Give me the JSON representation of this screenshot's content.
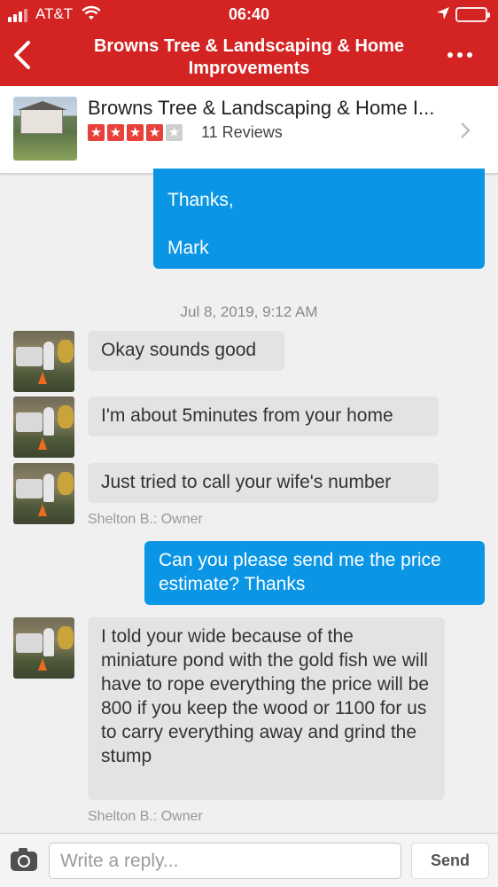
{
  "status_bar": {
    "carrier": "AT&T",
    "time": "06:40"
  },
  "nav": {
    "title": "Browns Tree & Landscaping & Home Improvements",
    "back_icon": "chevron-left-icon",
    "more_icon": "more-icon"
  },
  "business": {
    "name": "Browns Tree & Landscaping & Home I...",
    "rating": 4,
    "rating_max": 5,
    "reviews": "11 Reviews"
  },
  "messages": {
    "m1_line1": "Thanks,",
    "m1_line2": "Mark",
    "date": "Jul 8, 2019, 9:12 AM",
    "m2": "Okay sounds good",
    "m3": "I'm about 5minutes from your home",
    "m4": "Just tried to call your wife's number",
    "owner1": "Shelton B.: Owner",
    "m5": "Can you please send me the price estimate? Thanks",
    "m6": "I told your wide because of the miniature pond with the gold fish we will have to rope everything the price will be 800 if you keep the wood or 1100 for us to carry everything away and grind the stump",
    "owner2": "Shelton B.: Owner"
  },
  "composer": {
    "placeholder": "Write a reply...",
    "send_label": "Send"
  },
  "colors": {
    "brand": "#d32323",
    "outgoing": "#0a95e5",
    "incoming": "#e3e3e3",
    "star": "#e8403a"
  }
}
